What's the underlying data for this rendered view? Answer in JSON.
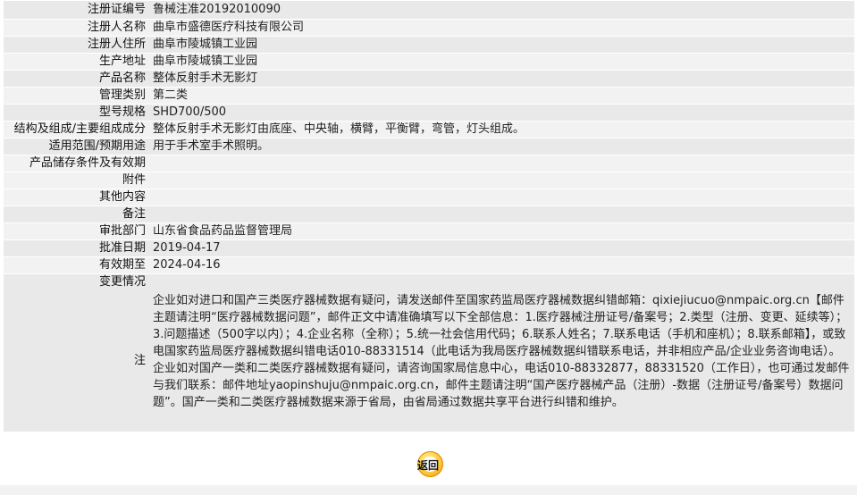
{
  "rows": [
    {
      "label": "注册证编号",
      "value": "鲁械注准20192010090"
    },
    {
      "label": "注册人名称",
      "value": "曲阜市盛德医疗科技有限公司"
    },
    {
      "label": "注册人住所",
      "value": "曲阜市陵城镇工业园"
    },
    {
      "label": "生产地址",
      "value": "曲阜市陵城镇工业园"
    },
    {
      "label": "产品名称",
      "value": "整体反射手术无影灯"
    },
    {
      "label": "管理类别",
      "value": "第二类"
    },
    {
      "label": "型号规格",
      "value": "SHD700/500"
    },
    {
      "label": "结构及组成/主要组成成分",
      "value": "整体反射手术无影灯由底座、中央轴，横臂，平衡臂，弯管，灯头组成。"
    },
    {
      "label": "适用范围/预期用途",
      "value": "用于手术室手术照明。"
    },
    {
      "label": "产品储存条件及有效期",
      "value": ""
    },
    {
      "label": "附件",
      "value": ""
    },
    {
      "label": "其他内容",
      "value": ""
    },
    {
      "label": "备注",
      "value": ""
    },
    {
      "label": "审批部门",
      "value": "山东省食品药品监督管理局"
    },
    {
      "label": "批准日期",
      "value": "2019-04-17"
    },
    {
      "label": "有效期至",
      "value": "2024-04-16"
    },
    {
      "label": "变更情况",
      "value": ""
    }
  ],
  "notice": {
    "label": "注",
    "text": "企业如对进口和国产三类医疗器械数据有疑问，请发送邮件至国家药监局医疗器械数据纠错邮箱：qixiejiucuo@nmpaic.org.cn【邮件主题请注明“医疗器械数据问题”，邮件正文中请准确填写以下全部信息：1.医疗器械注册证号/备案号；2.类型（注册、变更、延续等）；3.问题描述（500字以内）；4.企业名称（全称）；5.统一社会信用代码；6.联系人姓名；7.联系电话（手机和座机）；8.联系邮箱】，或致电国家药监局医疗器械数据纠错电话010-88331514（此电话为我局医疗器械数据纠错联系电话，并非相应产品/企业业务咨询电话）。企业如对国产一类和二类医疗器械数据有疑问，请咨询国家局信息中心，电话010-88332877，88331520（工作日），也可通过发邮件与我们联系：邮件地址yaopinshuju@nmpaic.org.cn，邮件主题请注明“国产医疗器械产品（注册）-数据（注册证号/备案号）数据问题”。国产一类和二类医疗器械数据来源于省局，由省局通过数据共享平台进行纠错和维护。"
  },
  "back_button": {
    "label": "返回"
  }
}
